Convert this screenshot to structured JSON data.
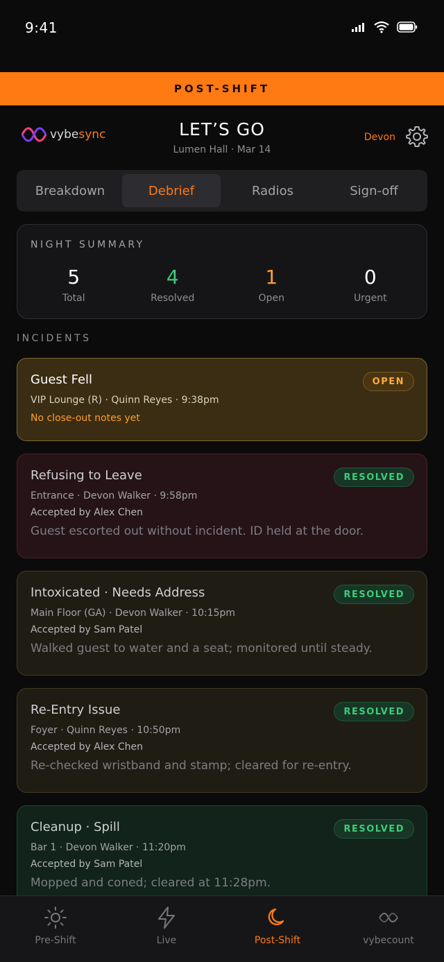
{
  "status_bar": {
    "time": "9:41"
  },
  "banner": {
    "label": "POST-SHIFT"
  },
  "header": {
    "logo_text_main": "vybe",
    "logo_text_accent": "sync",
    "title": "LET’S GO",
    "subtitle": "Lumen Hall · Mar 14",
    "user_name": "Devon",
    "settings_icon": "gear-icon"
  },
  "tabs": [
    {
      "label": "Breakdown",
      "active": false
    },
    {
      "label": "Debrief",
      "active": true
    },
    {
      "label": "Radios",
      "active": false
    },
    {
      "label": "Sign-off",
      "active": false
    }
  ],
  "summary": {
    "title": "NIGHT SUMMARY",
    "stats": [
      {
        "value": "5",
        "label": "Total",
        "color": "#ffffff"
      },
      {
        "value": "4",
        "label": "Resolved",
        "color": "#3ecb79"
      },
      {
        "value": "1",
        "label": "Open",
        "color": "#ff9d2e"
      },
      {
        "value": "0",
        "label": "Urgent",
        "color": "#ffffff"
      }
    ]
  },
  "incidents_label": "INCIDENTS",
  "incidents": [
    {
      "title": "Guest Fell",
      "meta": "VIP Lounge (R) · Quinn Reyes · 9:38pm",
      "status": "OPEN",
      "warning": "No close-out notes yet"
    },
    {
      "title": "Refusing to Leave",
      "meta": "Entrance · Devon Walker · 9:58pm",
      "status": "RESOLVED",
      "accepted": "Accepted by Alex Chen",
      "note": "Guest escorted out without incident. ID held at the door."
    },
    {
      "title": "Intoxicated · Needs Address",
      "meta": "Main Floor (GA) · Devon Walker · 10:15pm",
      "status": "RESOLVED",
      "accepted": "Accepted by Sam Patel",
      "note": "Walked guest to water and a seat; monitored until steady."
    },
    {
      "title": "Re-Entry Issue",
      "meta": "Foyer · Quinn Reyes · 10:50pm",
      "status": "RESOLVED",
      "accepted": "Accepted by Alex Chen",
      "note": "Re-checked wristband and stamp; cleared for re-entry."
    },
    {
      "title": "Cleanup · Spill",
      "meta": "Bar 1 · Devon Walker · 11:20pm",
      "status": "RESOLVED",
      "accepted": "Accepted by Sam Patel",
      "note": "Mopped and coned; cleared at 11:28pm."
    }
  ],
  "bottom_nav": [
    {
      "label": "Pre-Shift",
      "icon": "sun-icon",
      "active": false
    },
    {
      "label": "Live",
      "icon": "lightning-icon",
      "active": false
    },
    {
      "label": "Post-Shift",
      "icon": "moon-icon",
      "active": true
    },
    {
      "label": "vybecount",
      "icon": "vybecount-logo-icon",
      "active": false
    }
  ],
  "colors": {
    "accent": "#ff7a12",
    "resolved": "#3ecb79",
    "open": "#ff9d2e"
  }
}
